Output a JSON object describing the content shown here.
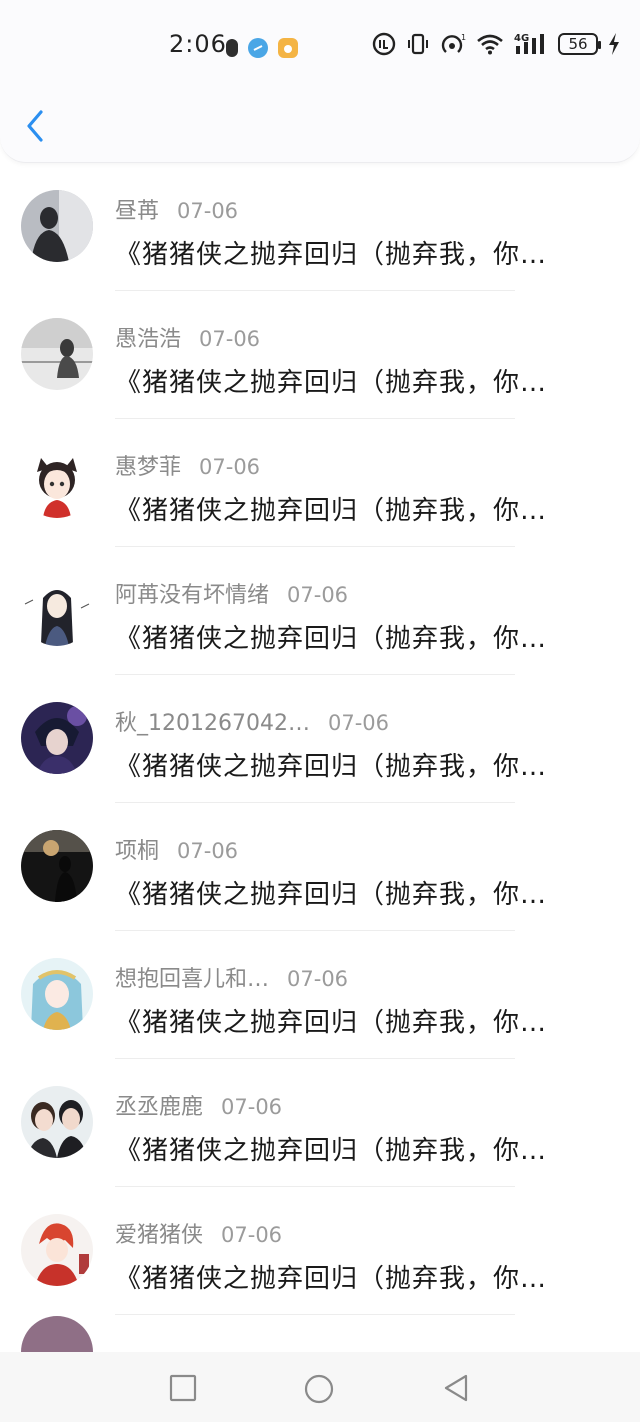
{
  "status_bar": {
    "time": "2:06",
    "network": "4G",
    "battery": "56"
  },
  "icons": {
    "back": "chevron-left-icon",
    "nav_recents": "square-icon",
    "nav_home": "circle-icon",
    "nav_back": "triangle-back-icon"
  },
  "colors": {
    "accent": "#2b8ff0",
    "username": "#8a8a8a",
    "date": "#9b9b9b"
  },
  "messages": [
    {
      "username": "昼苒",
      "date": "07-06",
      "text": "《猪猪侠之抛弃回归（抛弃我，你…"
    },
    {
      "username": "愚浩浩",
      "date": "07-06",
      "text": "《猪猪侠之抛弃回归（抛弃我，你…"
    },
    {
      "username": "惠梦菲",
      "date": "07-06",
      "text": "《猪猪侠之抛弃回归（抛弃我，你…"
    },
    {
      "username": "阿苒没有坏情绪",
      "date": "07-06",
      "text": "《猪猪侠之抛弃回归（抛弃我，你…"
    },
    {
      "username": "秋_1201267042…",
      "date": "07-06",
      "text": "《猪猪侠之抛弃回归（抛弃我，你…"
    },
    {
      "username": "项桐",
      "date": "07-06",
      "text": "《猪猪侠之抛弃回归（抛弃我，你…"
    },
    {
      "username": "想抱回喜儿和…",
      "date": "07-06",
      "text": "《猪猪侠之抛弃回归（抛弃我，你…"
    },
    {
      "username": "丞丞鹿鹿",
      "date": "07-06",
      "text": "《猪猪侠之抛弃回归（抛弃我，你…"
    },
    {
      "username": "爱猪猪侠",
      "date": "07-06",
      "text": "《猪猪侠之抛弃回归（抛弃我，你…"
    }
  ]
}
